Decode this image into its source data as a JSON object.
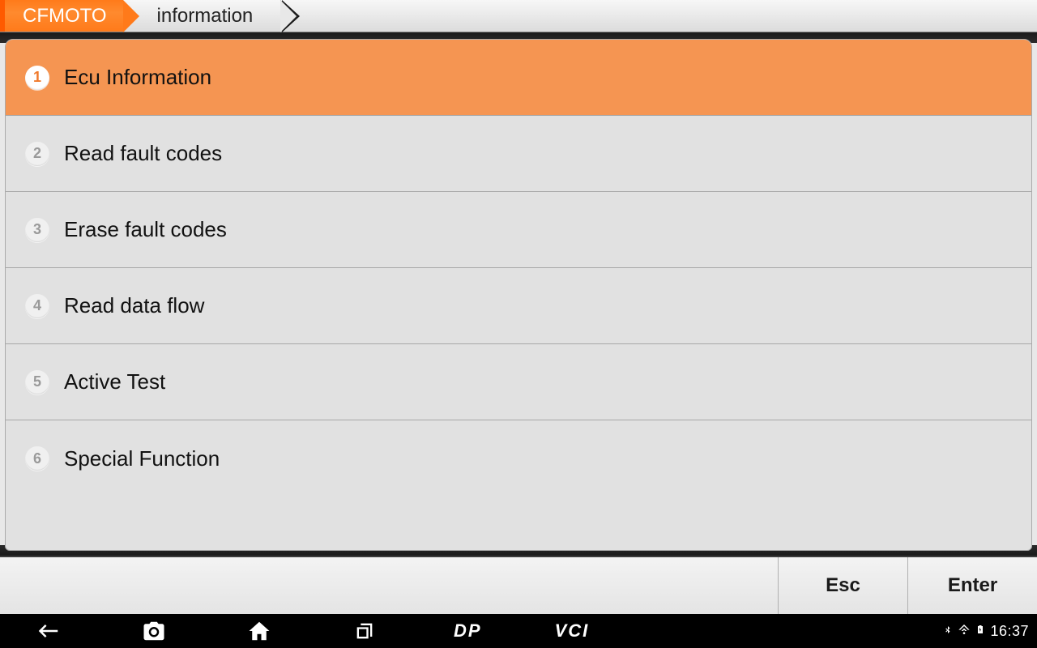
{
  "breadcrumb": {
    "root": "CFMOTO",
    "current": "information"
  },
  "menu": {
    "selected_index": 0,
    "items": [
      {
        "num": "1",
        "label": "Ecu Information"
      },
      {
        "num": "2",
        "label": "Read fault codes"
      },
      {
        "num": "3",
        "label": "Erase fault codes"
      },
      {
        "num": "4",
        "label": "Read data flow"
      },
      {
        "num": "5",
        "label": "Active Test"
      },
      {
        "num": "6",
        "label": "Special Function"
      }
    ]
  },
  "actions": {
    "esc": "Esc",
    "enter": "Enter"
  },
  "sysbar": {
    "dp": "DP",
    "vci": "VCI",
    "time": "16:37"
  }
}
